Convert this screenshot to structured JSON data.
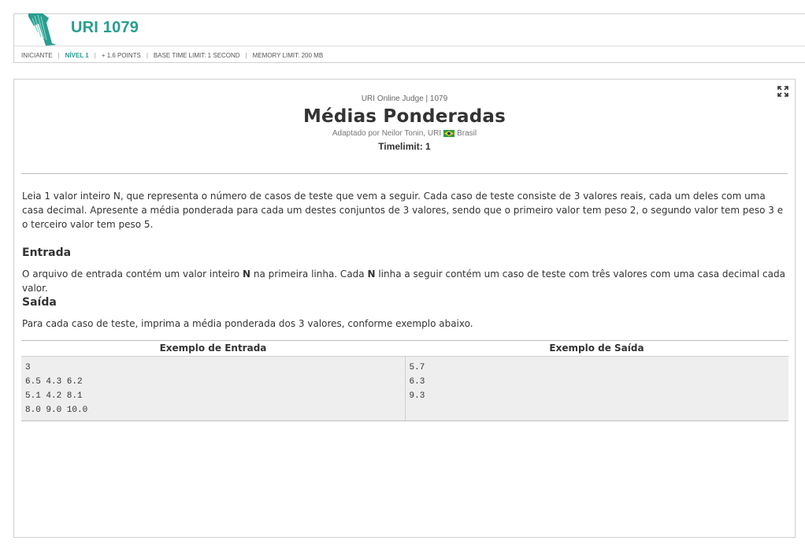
{
  "header": {
    "problem_code": "URI 1079",
    "meta": {
      "category": "INICIANTE",
      "level": "NÍVEL 1",
      "points": "+ 1.6 POINTS",
      "base_time_limit": "BASE TIME LIMIT: 1 SECOND",
      "memory_limit": "MEMORY LIMIT: 200 MB"
    },
    "logo_color": "#2a9d8f"
  },
  "problem": {
    "judge_line": "URI Online Judge | 1079",
    "title": "Médias Ponderadas",
    "author_prefix": "Adaptado por Neilor Tonin, URI",
    "country": "Brasil",
    "timelimit": "Timelimit: 1",
    "description": "Leia 1 valor inteiro N, que representa o número de casos de teste que vem a seguir. Cada caso de teste consiste de 3 valores reais, cada um deles com uma casa decimal. Apresente a média ponderada para cada um destes conjuntos de 3 valores, sendo que o primeiro valor tem peso 2, o segundo valor tem peso 3 e o terceiro valor tem peso 5."
  },
  "input_section": {
    "title": "Entrada",
    "text_1": "O arquivo de entrada contém um valor inteiro ",
    "bold_1": "N",
    "text_2": " na primeira linha. Cada ",
    "bold_2": "N",
    "text_3": " linha a seguir contém um caso de teste com três valores com uma casa decimal cada valor."
  },
  "output_section": {
    "title": "Saída",
    "text": "Para cada caso de teste, imprima a média ponderada dos 3 valores, conforme exemplo abaixo."
  },
  "examples": {
    "input_header": "Exemplo de Entrada",
    "output_header": "Exemplo de Saída",
    "input_lines": [
      "3",
      "6.5 4.3 6.2",
      "5.1 4.2 8.1",
      "8.0 9.0 10.0"
    ],
    "output_lines": [
      "5.7",
      "6.3",
      "9.3"
    ]
  },
  "icons": {
    "expand": "expand-icon",
    "flag": "brazil-flag-icon"
  }
}
